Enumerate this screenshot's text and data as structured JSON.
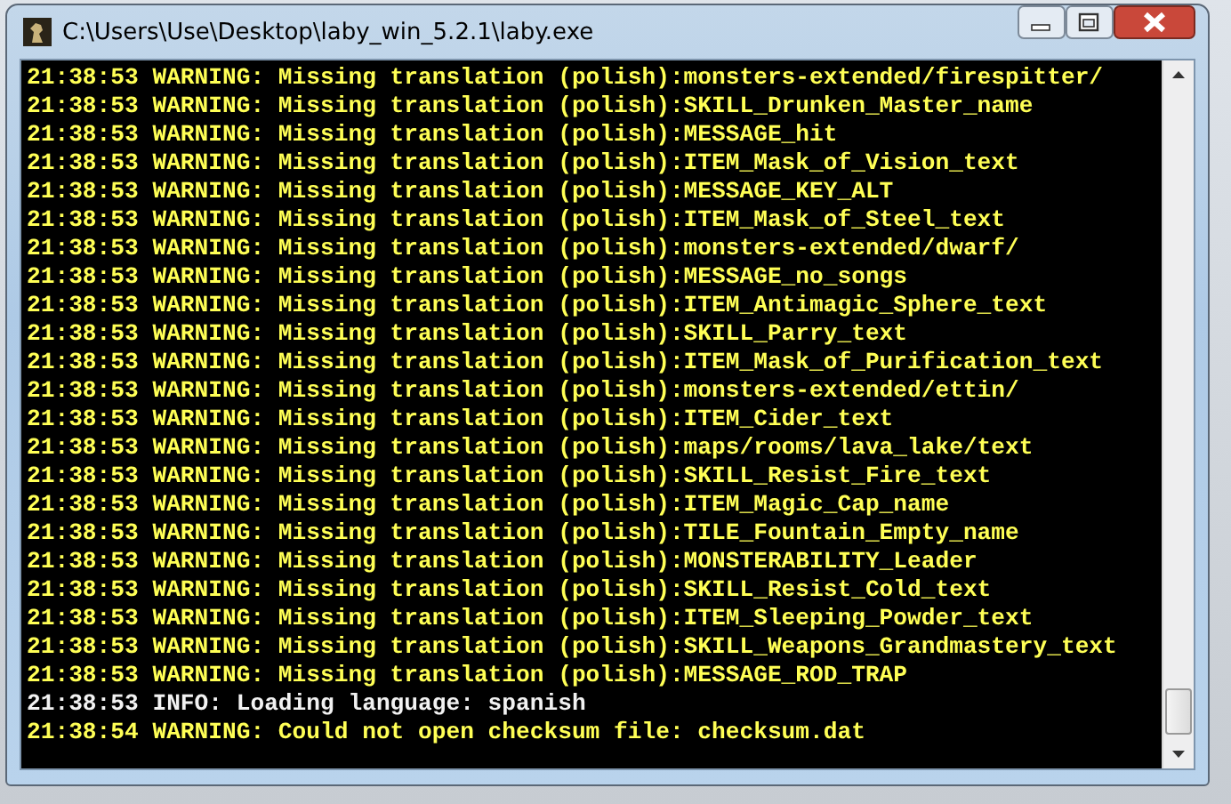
{
  "window": {
    "title": "C:\\Users\\Use\\Desktop\\laby_win_5.2.1\\laby.exe"
  },
  "console": {
    "lines": [
      {
        "kind": "warning",
        "text": "21:38:53 WARNING: Missing translation (polish):monsters-extended/firespitter/"
      },
      {
        "kind": "warning",
        "text": "21:38:53 WARNING: Missing translation (polish):SKILL_Drunken_Master_name"
      },
      {
        "kind": "warning",
        "text": "21:38:53 WARNING: Missing translation (polish):MESSAGE_hit"
      },
      {
        "kind": "warning",
        "text": "21:38:53 WARNING: Missing translation (polish):ITEM_Mask_of_Vision_text"
      },
      {
        "kind": "warning",
        "text": "21:38:53 WARNING: Missing translation (polish):MESSAGE_KEY_ALT"
      },
      {
        "kind": "warning",
        "text": "21:38:53 WARNING: Missing translation (polish):ITEM_Mask_of_Steel_text"
      },
      {
        "kind": "warning",
        "text": "21:38:53 WARNING: Missing translation (polish):monsters-extended/dwarf/"
      },
      {
        "kind": "warning",
        "text": "21:38:53 WARNING: Missing translation (polish):MESSAGE_no_songs"
      },
      {
        "kind": "warning",
        "text": "21:38:53 WARNING: Missing translation (polish):ITEM_Antimagic_Sphere_text"
      },
      {
        "kind": "warning",
        "text": "21:38:53 WARNING: Missing translation (polish):SKILL_Parry_text"
      },
      {
        "kind": "warning",
        "text": "21:38:53 WARNING: Missing translation (polish):ITEM_Mask_of_Purification_text"
      },
      {
        "kind": "warning",
        "text": "21:38:53 WARNING: Missing translation (polish):monsters-extended/ettin/"
      },
      {
        "kind": "warning",
        "text": "21:38:53 WARNING: Missing translation (polish):ITEM_Cider_text"
      },
      {
        "kind": "warning",
        "text": "21:38:53 WARNING: Missing translation (polish):maps/rooms/lava_lake/text"
      },
      {
        "kind": "warning",
        "text": "21:38:53 WARNING: Missing translation (polish):SKILL_Resist_Fire_text"
      },
      {
        "kind": "warning",
        "text": "21:38:53 WARNING: Missing translation (polish):ITEM_Magic_Cap_name"
      },
      {
        "kind": "warning",
        "text": "21:38:53 WARNING: Missing translation (polish):TILE_Fountain_Empty_name"
      },
      {
        "kind": "warning",
        "text": "21:38:53 WARNING: Missing translation (polish):MONSTERABILITY_Leader"
      },
      {
        "kind": "warning",
        "text": "21:38:53 WARNING: Missing translation (polish):SKILL_Resist_Cold_text"
      },
      {
        "kind": "warning",
        "text": "21:38:53 WARNING: Missing translation (polish):ITEM_Sleeping_Powder_text"
      },
      {
        "kind": "warning",
        "text": "21:38:53 WARNING: Missing translation (polish):SKILL_Weapons_Grandmastery_text"
      },
      {
        "kind": "warning",
        "text": "21:38:53 WARNING: Missing translation (polish):MESSAGE_ROD_TRAP"
      },
      {
        "kind": "info",
        "text": "21:38:53 INFO: Loading language: spanish"
      },
      {
        "kind": "warning",
        "text": "21:38:54 WARNING: Could not open checksum file: checksum.dat"
      }
    ]
  }
}
